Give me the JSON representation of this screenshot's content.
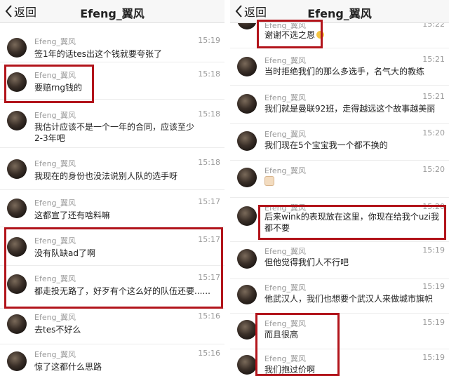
{
  "left": {
    "header": {
      "back_label": "返回",
      "title": "Efeng_翼风"
    },
    "messages": [
      {
        "name": "Efeng_翼风",
        "time": "15:19",
        "text": "签1年的话tes出这个钱就要夸张了"
      },
      {
        "name": "Efeng_翼风",
        "time": "15:18",
        "text": "要赔rng钱的"
      },
      {
        "name": "Efeng_翼风",
        "time": "15:18",
        "text": "我估计应该不是一个一年的合同，应该至少2-3年吧"
      },
      {
        "name": "Efeng_翼风",
        "time": "15:18",
        "text": "我现在的身份也没法说别人队的选手呀"
      },
      {
        "name": "Efeng_翼风",
        "time": "15:17",
        "text": "这都宣了还有啥料嘛"
      },
      {
        "name": "Efeng_翼风",
        "time": "15:17",
        "text": "没有队缺ad了啊"
      },
      {
        "name": "Efeng_翼风",
        "time": "15:17",
        "text": "都走投无路了，好歹有个这么好的队伍还要......"
      },
      {
        "name": "Efeng_翼风",
        "time": "15:16",
        "text": "去tes不好么"
      },
      {
        "name": "Efeng_翼风",
        "time": "15:16",
        "text": "惊了这都什么思路"
      }
    ]
  },
  "right": {
    "header": {
      "back_label": "返回",
      "title": "Efeng_翼风"
    },
    "messages": [
      {
        "name": "Efeng_翼风",
        "time": "15:22",
        "text": "谢谢不选之恩"
      },
      {
        "name": "Efeng_翼风",
        "time": "15:21",
        "text": "当时拒绝我们的那么多选手，名气大的教练"
      },
      {
        "name": "Efeng_翼风",
        "time": "15:21",
        "text": "我们就是曼联92班，走得越远这个故事越美丽"
      },
      {
        "name": "Efeng_翼风",
        "time": "15:20",
        "text": "我们现在5个宝宝我一个都不换的"
      },
      {
        "name": "Efeng_翼风",
        "time": "15:20",
        "text": ""
      },
      {
        "name": "Efeng_翼风",
        "time": "15:20",
        "text": "后来wink的表现放在这里，你现在给我个uzi我都不要"
      },
      {
        "name": "Efeng_翼风",
        "time": "15:19",
        "text": "但他觉得我们人不行吧"
      },
      {
        "name": "Efeng_翼风",
        "time": "15:19",
        "text": "他武汉人，我们也想要个武汉人来做城市旗帜"
      },
      {
        "name": "Efeng_翼风",
        "time": "15:19",
        "text": "而且很高"
      },
      {
        "name": "Efeng_翼风",
        "time": "15:19",
        "text": "我们抱过价啊"
      }
    ]
  },
  "colors": {
    "highlight": "#b2141b",
    "navbar": "#f7f7f7",
    "meta_text": "#9a9a9a"
  }
}
